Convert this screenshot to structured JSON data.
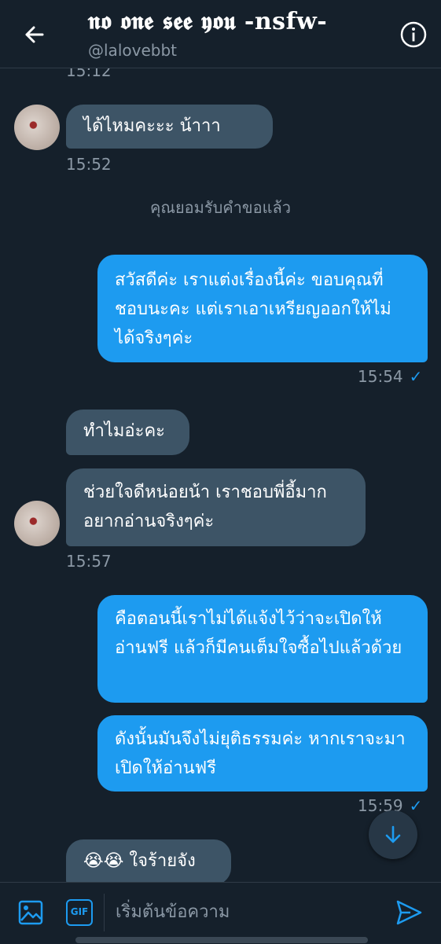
{
  "header": {
    "title": "𝖓𝖔 𝖔𝖓𝖊 𝖘𝖊𝖊 𝖞𝖔𝖚 -nsfw-",
    "handle": "@lalovebbt",
    "icons": {
      "back": "arrow-left-icon",
      "info": "info-circle-icon"
    }
  },
  "messages": {
    "ts_top": "15:12",
    "m1": "ได้ไหมคะะะ น้าาา",
    "ts1": "15:52",
    "notice": "คุณยอมรับคำขอแล้ว",
    "m2": "สวัสดีค่ะ เราแต่งเรื่องนี้ค่ะ ขอบคุณที่ชอบนะคะ แต่เราเอาเหรียญออกให้ไม่ได้จริงๆค่ะ",
    "ts2": "15:54",
    "m3": "ทำไมอ่ะคะ",
    "m4": "ช่วยใจดีหน่อยน้า เราชอบพี่อี้มาก อยากอ่านจริงๆค่ะ",
    "ts3": "15:57",
    "m5": "คือตอนนี้เราไม่ได้แจ้งไว้ว่าจะเปิดให้อ่านฟรี แล้วก็มีคนเต็มใจซื้อไปแล้วด้วย",
    "m6": "ดังนั้นมันจึงไม่ยุติธรรมค่ะ หากเราจะมาเปิดให้อ่านฟรี",
    "ts4": "15:59",
    "m7": "😭😭 ใจร้ายจัง",
    "read_mark": "✓"
  },
  "composer": {
    "placeholder": "เริ่มต้นข้อความ",
    "gif_label": "GIF",
    "icons": {
      "image": "image-icon",
      "send": "send-icon",
      "scroll": "arrow-down-icon"
    }
  },
  "colors": {
    "background": "#15202b",
    "accent": "#1d9bf0",
    "incoming_bubble": "#3d5466"
  }
}
